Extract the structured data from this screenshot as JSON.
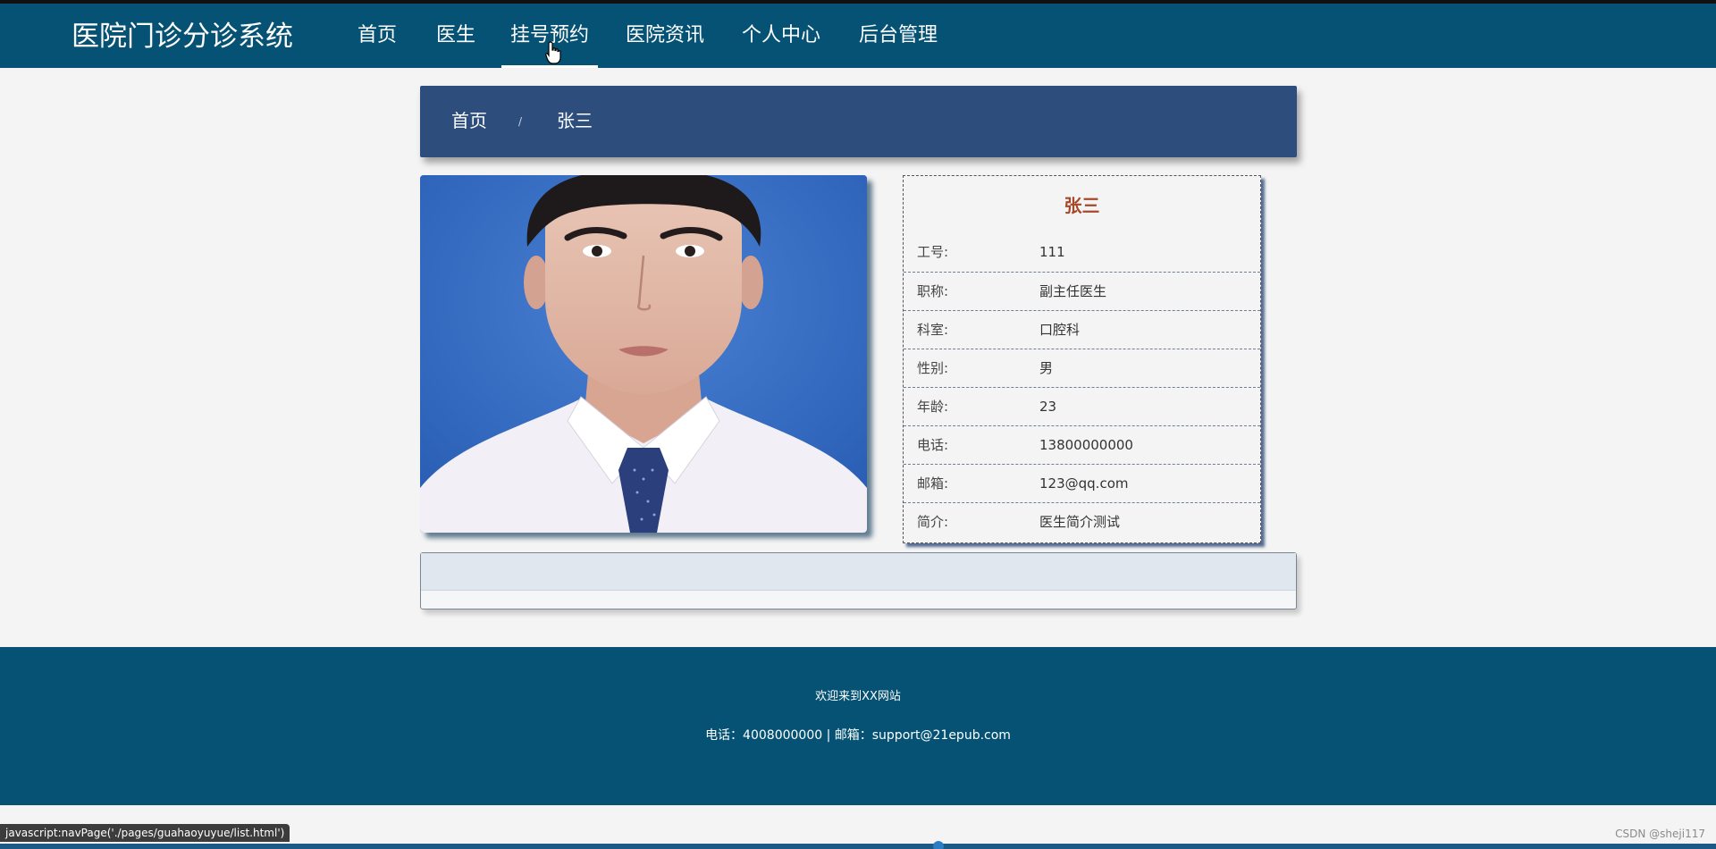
{
  "navbar": {
    "brand": "医院门诊分诊系统",
    "items": [
      {
        "label": "首页"
      },
      {
        "label": "医生"
      },
      {
        "label": "挂号预约"
      },
      {
        "label": "医院资讯"
      },
      {
        "label": "个人中心"
      },
      {
        "label": "后台管理"
      }
    ],
    "active_item": "挂号预约"
  },
  "breadcrumb": {
    "home": "首页",
    "separator": "/",
    "current": "张三"
  },
  "doctor": {
    "name": "张三",
    "fields": [
      {
        "label": "工号:",
        "value": "111"
      },
      {
        "label": "职称:",
        "value": "副主任医生"
      },
      {
        "label": "科室:",
        "value": "口腔科"
      },
      {
        "label": "性别:",
        "value": "男"
      },
      {
        "label": "年龄:",
        "value": "23"
      },
      {
        "label": "电话:",
        "value": "13800000000"
      },
      {
        "label": "邮箱:",
        "value": "123@qq.com"
      },
      {
        "label": "简介:",
        "value": "医生简介测试"
      }
    ]
  },
  "footer": {
    "welcome": "欢迎来到XX网站",
    "contact": "电话：4008000000 | 邮箱：support@21epub.com"
  },
  "status_bar": {
    "url": "javascript:navPage('./pages/guahaoyuyue/list.html')"
  },
  "watermark": "CSDN @sheji117",
  "colors": {
    "navbar": "#055274",
    "breadcrumb": "#2d4e7c",
    "doctor_name": "#a5492a",
    "footer": "#055274"
  }
}
